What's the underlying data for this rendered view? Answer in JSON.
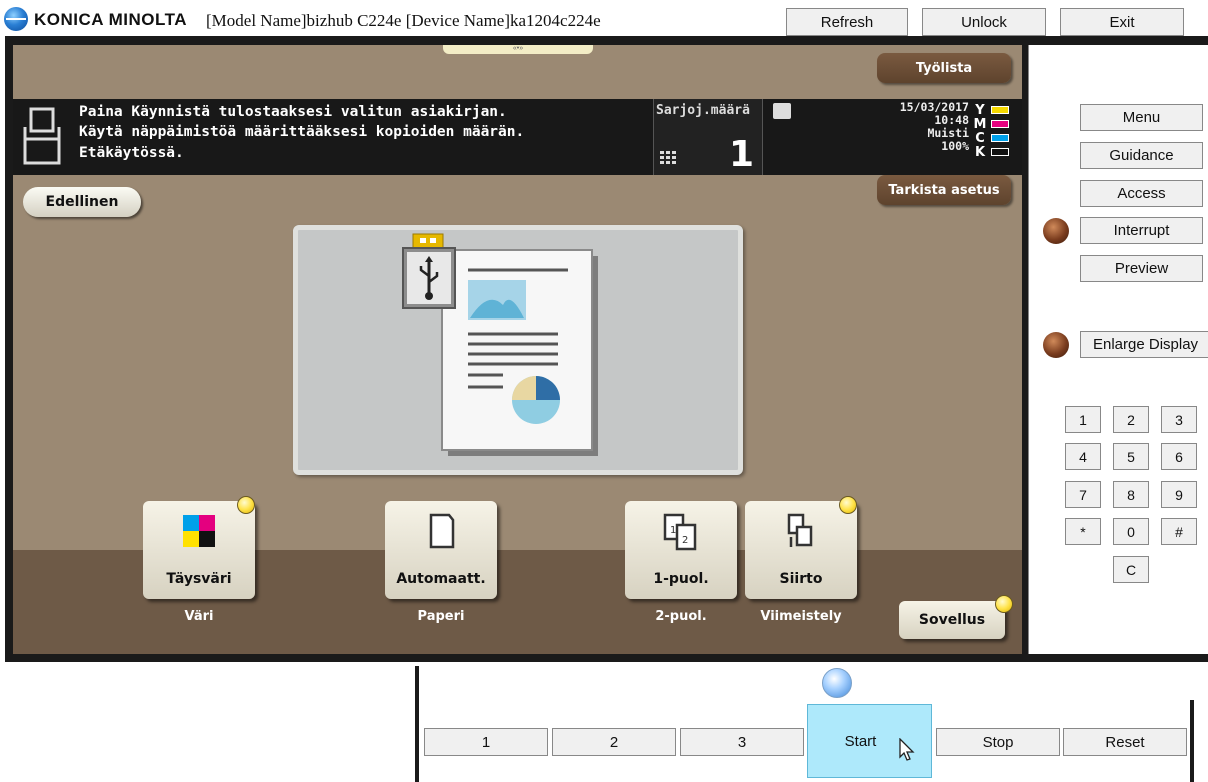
{
  "header": {
    "brand": "KONICA MINOLTA",
    "device_info": "[Model Name]bizhub C224e [Device Name]ka1204c224e",
    "refresh_label": "Refresh",
    "unlock_label": "Unlock",
    "exit_label": "Exit"
  },
  "panel": {
    "jobs_label": "Työlista",
    "check_settings_label": "Tarkista asetus",
    "message_lines": [
      "Paina Käynnistä tulostaaksesi valitun asiakirjan.",
      "Käytä näppäimistöä määrittääksesi kopioiden määrän.",
      "Etäkäytössä."
    ],
    "copies_label": "Sarjoj.määrä",
    "copies_value": "1",
    "date": "15/03/2017",
    "time": "10:48",
    "memory_label": "Muisti",
    "memory_value": "100%",
    "toner": [
      {
        "letter": "Y",
        "color": "#f5d800"
      },
      {
        "letter": "M",
        "color": "#e6007e"
      },
      {
        "letter": "C",
        "color": "#00a0e9"
      },
      {
        "letter": "K",
        "color": "#111111"
      }
    ],
    "back_label": "Edellinen",
    "functions": [
      {
        "label": "Täysväri",
        "caption": "Väri",
        "icon": "color-squares-icon",
        "indicator": true
      },
      {
        "label": "Automaatt.",
        "caption": "Paperi",
        "icon": "paper-icon",
        "indicator": false
      },
      {
        "label": "1-puol.",
        "caption": "2-puol.",
        "icon": "duplex-icon",
        "indicator": false
      },
      {
        "label": "Siirto",
        "caption": "Viimeistely",
        "icon": "finishing-icon",
        "indicator": true
      }
    ],
    "app_label": "Sovellus"
  },
  "side": {
    "menu_label": "Menu",
    "guidance_label": "Guidance",
    "access_label": "Access",
    "interrupt_label": "Interrupt",
    "preview_label": "Preview",
    "enlarge_label": "Enlarge Display",
    "keys": [
      "1",
      "2",
      "3",
      "4",
      "5",
      "6",
      "7",
      "8",
      "9",
      "*",
      "0",
      "#"
    ],
    "clear_label": "C"
  },
  "bottom": {
    "buttons": [
      "1",
      "2",
      "3"
    ],
    "start_label": "Start",
    "stop_label": "Stop",
    "reset_label": "Reset"
  }
}
